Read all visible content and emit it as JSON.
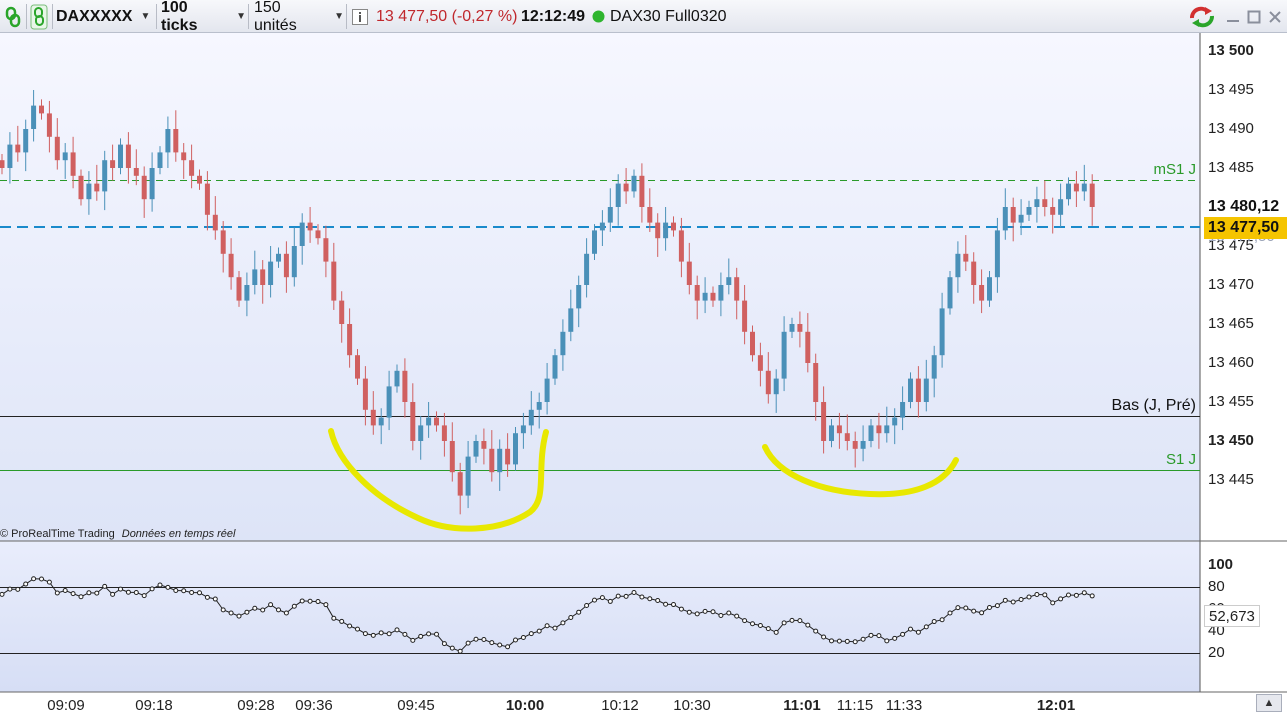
{
  "toolbar": {
    "instrument": "DAXXXXX",
    "period": "100 ticks",
    "units": "150 unités",
    "price_change": "13 477,50 (-0,27 %)",
    "time": "12:12:49",
    "feed": "DAX30 Full0320",
    "window_controls": [
      "refresh-icon",
      "minimize-icon",
      "maximize-icon",
      "close-icon"
    ]
  },
  "price_axis": {
    "ticks": [
      "13 500",
      "13 495",
      "13 490",
      "13 485",
      "13 475",
      "13 470",
      "13 465",
      "13 460",
      "13 455",
      "13 450",
      "13 445"
    ],
    "bold_ticks": [
      "13 500",
      "13 450"
    ],
    "high_badge": "13 480,12",
    "current_badge": "13 477,50",
    "ghost_label": "13 477,50"
  },
  "levels": {
    "ms1_label": "mS1 J",
    "bas_label": "Bas (J, Pré)",
    "s1_label": "S1 J"
  },
  "credit": {
    "brand": "© ProRealTime Trading",
    "note": "Données en temps réel"
  },
  "indicator": {
    "ticks": [
      "100",
      "80",
      "60",
      "40",
      "20"
    ],
    "value": "52,673"
  },
  "time_axis": {
    "labels": [
      "09:09",
      "09:18",
      "09:28",
      "09:36",
      "09:45",
      "10:00",
      "10:12",
      "10:30",
      "11:01",
      "11:15",
      "11:33",
      "12:01"
    ],
    "bold_labels": [
      "10:00",
      "11:01",
      "12:01"
    ]
  },
  "colors": {
    "bull": "#4a90b8",
    "bear": "#d06060",
    "highlight": "#e8e800",
    "level_green": "#2a9a2a",
    "level_blue": "#1a8acb",
    "badge_current": "#f5c400"
  },
  "chart_data": {
    "type": "candlestick",
    "instrument": "DAXXXXX",
    "period": "100 ticks",
    "ylim": [
      13441.5,
      13501
    ],
    "levels": [
      {
        "name": "mS1 J",
        "value": 13483.5
      },
      {
        "name": "Bas (J, Pré)",
        "value": 13454.5
      },
      {
        "name": "S1 J",
        "value": 13448.3
      },
      {
        "name": "current",
        "value": 13477.5
      }
    ],
    "closes": [
      13485,
      13488,
      13487,
      13490,
      13493,
      13492,
      13489,
      13486,
      13487,
      13484,
      13481,
      13483,
      13482,
      13486,
      13485,
      13488,
      13485,
      13484,
      13481,
      13485,
      13487,
      13490,
      13487,
      13486,
      13484,
      13483,
      13479,
      13477,
      13474,
      13471,
      13468,
      13470,
      13472,
      13470,
      13473,
      13474,
      13471,
      13475,
      13478,
      13477,
      13476,
      13473,
      13468,
      13465,
      13461,
      13458,
      13454,
      13452,
      13453,
      13457,
      13459,
      13455,
      13450,
      13452,
      13453,
      13452,
      13450,
      13446,
      13443,
      13448,
      13450,
      13449,
      13446,
      13449,
      13447,
      13451,
      13452,
      13454,
      13455,
      13458,
      13461,
      13464,
      13467,
      13470,
      13474,
      13477,
      13478,
      13480,
      13483,
      13482,
      13484,
      13480,
      13478,
      13476,
      13478,
      13477,
      13473,
      13470,
      13468,
      13469,
      13468,
      13470,
      13471,
      13468,
      13464,
      13461,
      13459,
      13456,
      13458,
      13464,
      13465,
      13464,
      13460,
      13455,
      13450,
      13452,
      13451,
      13450,
      13449,
      13450,
      13452,
      13451,
      13452,
      13453,
      13455,
      13458,
      13455,
      13458,
      13461,
      13467,
      13471,
      13474,
      13473,
      13470,
      13468,
      13471,
      13477,
      13480,
      13478,
      13479,
      13480,
      13481,
      13480,
      13479,
      13481,
      13483,
      13482,
      13483,
      13480
    ]
  }
}
